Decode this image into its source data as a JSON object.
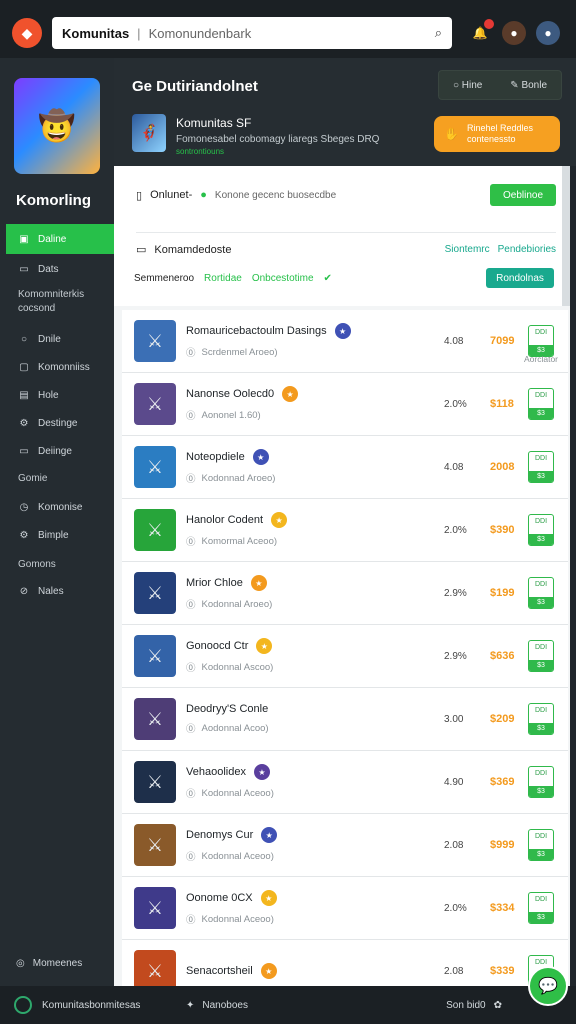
{
  "topbar": {
    "app_name": "Komunitas",
    "search_placeholder": "Komonundenbark",
    "notif_icon": "bell-icon",
    "avatar1_icon": "user-avatar",
    "avatar2_icon": "user-avatar"
  },
  "sidebar": {
    "title": "Komorling",
    "items": [
      {
        "label": "Daline",
        "icon": "square-icon"
      },
      {
        "label": "Dats",
        "icon": "monitor-icon"
      },
      {
        "label": "Komomniterkis cocsond",
        "icon": ""
      },
      {
        "label": "Dnile",
        "icon": "circle-icon"
      },
      {
        "label": "Komonniiss",
        "icon": "chat-icon"
      },
      {
        "label": "Hole",
        "icon": "doc-icon"
      },
      {
        "label": "Destinge",
        "icon": "settings-icon"
      },
      {
        "label": "Deiinge",
        "icon": "card-icon"
      },
      {
        "label": "Gomie",
        "icon": ""
      },
      {
        "label": "Komonise",
        "icon": "clock-icon"
      },
      {
        "label": "Bimple",
        "icon": "gear-icon"
      },
      {
        "label": "Gomons",
        "icon": ""
      },
      {
        "label": "Nales",
        "icon": "check-icon"
      }
    ],
    "footer": "Momeenes"
  },
  "header": {
    "title": "Ge Dutiriandolnet",
    "tab_left": "Hine",
    "tab_right": "Bonle",
    "user_name": "Komunitas SF",
    "user_sub": "Fomonesabel cobomagy liaregs Sbeges DRQ",
    "user_sub2": "sontrontiouns",
    "cta_line1": "Rinehel Reddles",
    "cta_line2": "contenessto"
  },
  "filters": {
    "row1_label": "Onlunet-",
    "row1_desc": "Konone gecenc buosecdbe",
    "row1_button": "Oeblinoe",
    "row2_label": "Komamdedoste",
    "row2_tab1": "Siontemrc",
    "row2_tab2": "Pendebiories",
    "row3_label": "Semmeneroo",
    "row3_g1": "Rortidae",
    "row3_g2": "Onbcestotime",
    "row3_button": "Rondolnas"
  },
  "games": [
    {
      "name": "Romauricebactoulm Dasings",
      "meta": "Scrdenmel Aroeo)",
      "rating": "4.08",
      "price": "7099",
      "mini_top": "DDI",
      "mini_bot": "$3",
      "extra": "Aorclator",
      "thumb": "#3b6fb5",
      "badge": "#3f51b5"
    },
    {
      "name": "Nanonse Oolecd0",
      "meta": "Aononel 1.60)",
      "rating": "2.0%",
      "price": "$118",
      "mini_top": "DDI",
      "mini_bot": "$3",
      "extra": "",
      "thumb": "#5b4a8c",
      "badge": "#f39a1e"
    },
    {
      "name": "Noteopdiele",
      "meta": "Kodonnad Aroeo)",
      "rating": "4.08",
      "price": "2008",
      "mini_top": "DDI",
      "mini_bot": "$3",
      "extra": "",
      "thumb": "#2b7dc2",
      "badge": "#3f51b5"
    },
    {
      "name": "Hanolor Codent",
      "meta": "Komormal Aceoo)",
      "rating": "2.0%",
      "price": "$390",
      "mini_top": "DDI",
      "mini_bot": "$3",
      "extra": "",
      "thumb": "#27a53a",
      "badge": "#f3b61e"
    },
    {
      "name": "Mrior Chloe",
      "meta": "Kodonnal Aroeo)",
      "rating": "2.9%",
      "price": "$199",
      "mini_top": "DDI",
      "mini_bot": "$3",
      "extra": "",
      "thumb": "#24407a",
      "badge": "#f39a1e"
    },
    {
      "name": "Gonoocd Ctr",
      "meta": "Kodonnal Ascoo)",
      "rating": "2.9%",
      "price": "$636",
      "mini_top": "DDI",
      "mini_bot": "$3",
      "extra": "",
      "thumb": "#3363a8",
      "badge": "#f3b61e"
    },
    {
      "name": "Deodryy'S Conle",
      "meta": "Aodonnal Acoo)",
      "rating": "3.00",
      "price": "$209",
      "mini_top": "DDI",
      "mini_bot": "$3",
      "extra": "",
      "thumb": "#4e3d76",
      "badge": ""
    },
    {
      "name": "Vehaoolidex",
      "meta": "Kodonnal Aceoo)",
      "rating": "4.90",
      "price": "$369",
      "mini_top": "DDI",
      "mini_bot": "$3",
      "extra": "",
      "thumb": "#1e2f4a",
      "badge": "#5a3f9e"
    },
    {
      "name": "Denomys Cur",
      "meta": "Kodonnal Aceoo)",
      "rating": "2.08",
      "price": "$999",
      "mini_top": "DDI",
      "mini_bot": "$3",
      "extra": "",
      "thumb": "#8a5a2a",
      "badge": "#3f51b5"
    },
    {
      "name": "Oonome 0CX",
      "meta": "Kodonnal Aceoo)",
      "rating": "2.0%",
      "price": "$334",
      "mini_top": "DDI",
      "mini_bot": "$3",
      "extra": "",
      "thumb": "#3f3a8a",
      "badge": "#f3b61e"
    },
    {
      "name": "Senacortsheil",
      "meta": "",
      "rating": "2.08",
      "price": "$339",
      "mini_top": "DDI",
      "mini_bot": "",
      "extra": "",
      "thumb": "#c24a1e",
      "badge": "#f39a1e"
    }
  ],
  "bottombar": {
    "left": "Komunitasbonmitesas",
    "mid": "Nanoboes",
    "right": "Son bid0"
  },
  "colors": {
    "accent_green": "#27c04a",
    "accent_orange": "#f6a021",
    "accent_teal": "#19a98e",
    "dark_bg": "#1b2024"
  }
}
